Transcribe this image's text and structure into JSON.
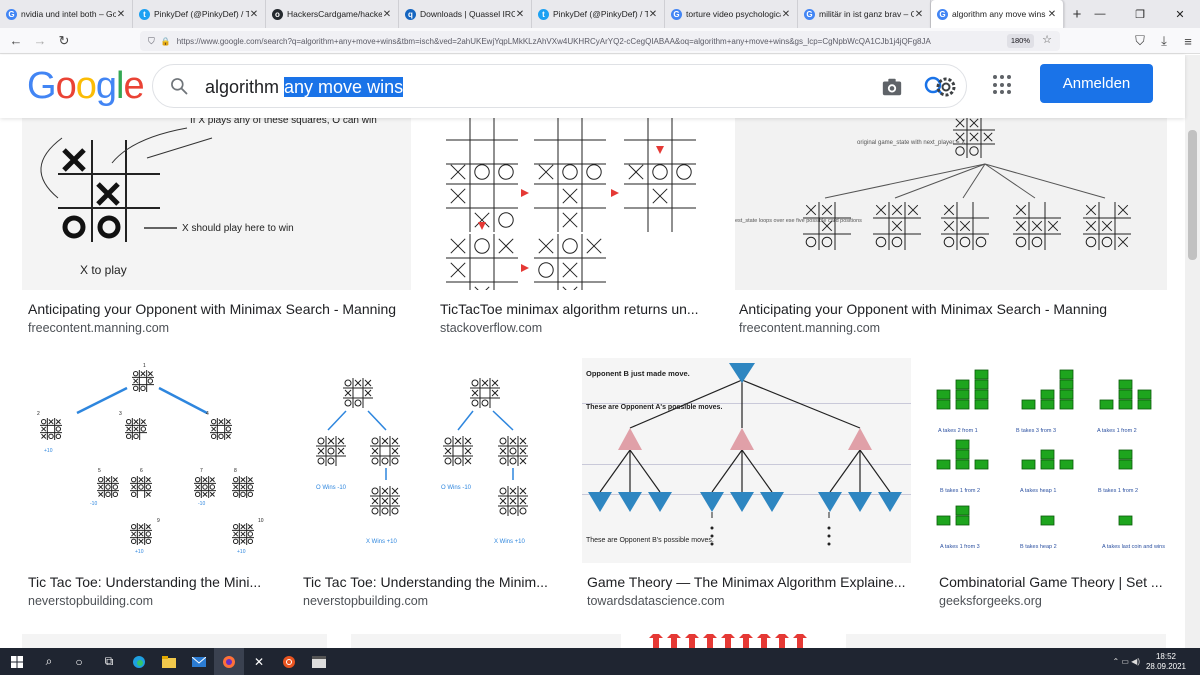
{
  "browser": {
    "tabs": [
      {
        "label": "nvidia und intel both – Googl",
        "fav": "G",
        "color": "#4285f4"
      },
      {
        "label": "PinkyDef (@PinkyDef) / Twitte",
        "fav": "t",
        "color": "#1da1f2"
      },
      {
        "label": "HackersCardgame/hackersca",
        "fav": "o",
        "color": "#24292e"
      },
      {
        "label": "Downloads | Quassel IRC",
        "fav": "q",
        "color": "#1565c0"
      },
      {
        "label": "PinkyDef (@PinkyDef) / Twitte",
        "fav": "t",
        "color": "#1da1f2"
      },
      {
        "label": "torture video psychological w",
        "fav": "G",
        "color": "#4285f4"
      },
      {
        "label": "militär in ist ganz brav – Goog",
        "fav": "G",
        "color": "#4285f4"
      },
      {
        "label": "algorithm any move wins – Go",
        "fav": "G",
        "color": "#4285f4",
        "active": true
      }
    ],
    "tab_close": "✕",
    "new_tab": "+",
    "url": "https://www.google.com/search?q=algorithm+any+move+wins&tbm=isch&ved=2ahUKEwjYqpLMkKLzAhVXw4UKHRCyArYQ2-cCegQIABAA&oq=algorithm+any+move+wins&gs_lcp=CgNpbWcQA1CJb1j4jQFg8JA",
    "url_domain": "www.google.com",
    "zoom": "180%"
  },
  "google": {
    "logo": [
      "G",
      "o",
      "o",
      "g",
      "l",
      "e"
    ],
    "logo_colors": [
      "#4285f4",
      "#ea4335",
      "#fbbc05",
      "#4285f4",
      "#34a853",
      "#ea4335"
    ],
    "query_plain": "algorithm ",
    "query_selected": "any move wins",
    "signin": "Anmelden"
  },
  "results": [
    {
      "title": "Anticipating your Opponent with Minimax Search - Manning",
      "source": "freecontent.manning.com",
      "thumb_caption": "X to play",
      "thumb_note": "If X plays any of these squares, O can win",
      "thumb_note2": "X should play here to win"
    },
    {
      "title": "TicTacToe minimax algorithm returns un...",
      "source": "stackoverflow.com"
    },
    {
      "title": "Anticipating your Opponent with Minimax Search - Manning",
      "source": "freecontent.manning.com",
      "thumb_note": "original game_state with next_player = X",
      "thumb_note2": "est_state loops over ese five possible card positions"
    },
    {
      "title": "Tic Tac Toe: Understanding the Mini...",
      "source": "neverstopbuilding.com",
      "thumb_labels": [
        "1",
        "2",
        "3",
        "4",
        "5",
        "6",
        "7",
        "8",
        "9",
        "10",
        "+10",
        "-10",
        "-10",
        "+10",
        "+10"
      ]
    },
    {
      "title": "Tic Tac Toe: Understanding the Minim...",
      "source": "neverstopbuilding.com",
      "thumb_labels": [
        "O Wins -10",
        "O Wins -10",
        "X Wins +10",
        "X Wins +10"
      ]
    },
    {
      "title": "Game Theory — The Minimax Algorithm Explaine...",
      "source": "towardsdatascience.com",
      "thumb_labels": [
        "Opponent B just made move.",
        "These are Opponent A's possible moves.",
        "These are Opponent B's possible moves."
      ]
    },
    {
      "title": "Combinatorial Game Theory | Set ...",
      "source": "geeksforgeeks.org",
      "thumb_labels": [
        "A takes 2 from 1",
        "B takes 3 from 3",
        "A takes 1 from 2",
        "B takes 1 from 2",
        "A takes heap 1",
        "B takes 1 from 2",
        "A takes 1 from 3",
        "B takes heap 2",
        "A takes last coin and wins"
      ]
    }
  ],
  "taskbar": {
    "time": "18:52",
    "date": "28.09.2021"
  }
}
